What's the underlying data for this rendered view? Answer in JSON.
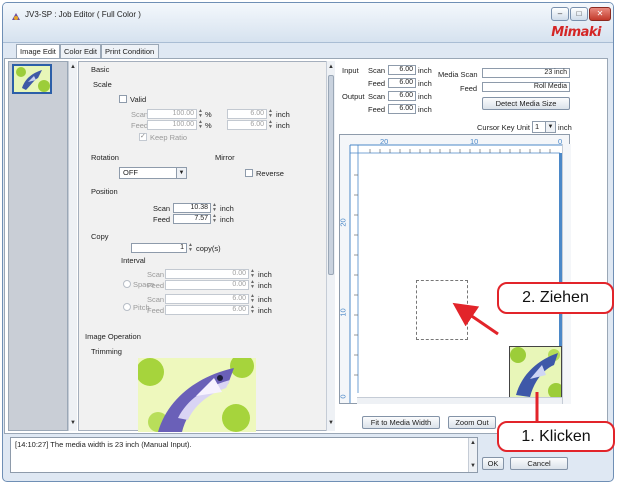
{
  "window": {
    "title": "JV3-SP : Job Editor ( Full Color )",
    "logo": "Mimaki"
  },
  "tabs": [
    "Image Edit",
    "Color Edit",
    "Print Condition"
  ],
  "basic": {
    "heading": "Basic",
    "scale": {
      "heading": "Scale",
      "valid_label": "Valid",
      "scan_label": "Scan",
      "feed_label": "Feed",
      "scan_percent": "100.00",
      "feed_percent": "100.00",
      "percent_unit": "%",
      "scan_inch": "6.00",
      "feed_inch": "6.00",
      "inch_unit": "inch",
      "keep_ratio_label": "Keep Ratio"
    },
    "rotation": {
      "heading": "Rotation",
      "value": "OFF"
    },
    "mirror": {
      "heading": "Mirror",
      "reverse_label": "Reverse"
    },
    "position": {
      "heading": "Position",
      "scan_label": "Scan",
      "feed_label": "Feed",
      "scan_value": "10.38",
      "feed_value": "7.57",
      "unit": "inch"
    },
    "copy": {
      "heading": "Copy",
      "count": "1",
      "count_unit": "copy(s)",
      "interval_label": "Interval",
      "space_label": "Space",
      "pitch_label": "Pitch",
      "scan_label": "Scan",
      "feed_label": "Feed",
      "space_scan": "0.00",
      "space_feed": "0.00",
      "pitch_scan": "6.00",
      "pitch_feed": "6.00",
      "unit": "inch"
    }
  },
  "image_operation": {
    "heading": "Image Operation",
    "trimming_label": "Trimming"
  },
  "info": {
    "input_label": "Input",
    "output_label": "Output",
    "scan_label": "Scan",
    "feed_label": "Feed",
    "input_scan": "6.00",
    "input_feed": "6.00",
    "output_scan": "6.00",
    "output_feed": "6.00",
    "unit": "inch",
    "media_scan_label": "Media Scan",
    "media_feed_label": "Feed",
    "media_scan_value": "23 inch",
    "media_feed_value": "Roll Media",
    "detect_button": "Detect Media Size",
    "cursor_key_label": "Cursor Key Unit",
    "cursor_key_value": "1",
    "cursor_key_unit": "inch"
  },
  "ruler": {
    "top": [
      "20",
      "10",
      "0"
    ],
    "left": [
      "20",
      "10",
      "0"
    ]
  },
  "buttons": {
    "fit_width": "Fit to Media Width",
    "zoom_out": "Zoom Out",
    "ok": "OK",
    "cancel": "Cancel"
  },
  "log": {
    "message": "[14:10:27] The media width is 23 inch (Manual Input)."
  },
  "callouts": {
    "step1": "1. Klicken",
    "step2": "2. Ziehen"
  },
  "colors": {
    "accent": "#2c5fa8",
    "callout": "#e2242a",
    "logo": "#d42626"
  }
}
